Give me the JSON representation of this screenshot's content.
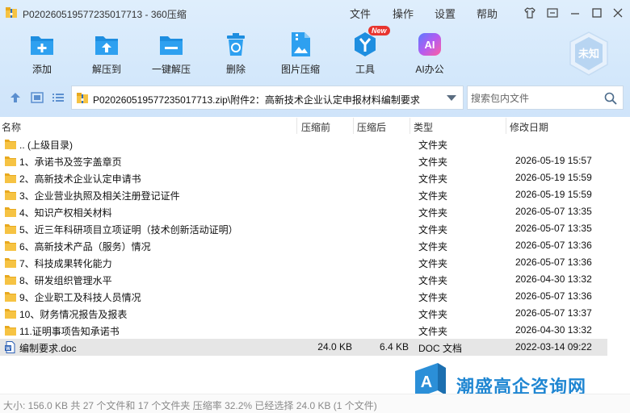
{
  "window": {
    "title": "P020260519577235017713 - 360压缩",
    "menus": [
      "文件",
      "操作",
      "设置",
      "帮助"
    ]
  },
  "toolbar": {
    "items": [
      {
        "label": "添加",
        "icon": "add-icon"
      },
      {
        "label": "解压到",
        "icon": "extract-to-icon"
      },
      {
        "label": "一键解压",
        "icon": "one-click-extract-icon"
      },
      {
        "label": "删除",
        "icon": "delete-icon"
      },
      {
        "label": "图片压缩",
        "icon": "image-compress-icon"
      },
      {
        "label": "工具",
        "icon": "tools-icon"
      },
      {
        "label": "AI办公",
        "icon": "ai-office-icon"
      }
    ],
    "new_badge": "New",
    "ai_icon_text": "AI",
    "account_badge": "未知"
  },
  "address": {
    "path": "P020260519577235017713.zip\\附件2：高新技术企业认定申报材料编制要求"
  },
  "search": {
    "placeholder": "搜索包内文件"
  },
  "columns": {
    "name": "名称",
    "original_size": "压缩前",
    "compressed_size": "压缩后",
    "type": "类型",
    "modified": "修改日期"
  },
  "files": [
    {
      "name": ".. (上级目录)",
      "original": "",
      "compressed": "",
      "type": "文件夹",
      "date": "",
      "kind": "folder"
    },
    {
      "name": "1、承诺书及签字盖章页",
      "original": "",
      "compressed": "",
      "type": "文件夹",
      "date": "2026-05-19 15:57",
      "kind": "folder"
    },
    {
      "name": "2、高新技术企业认定申请书",
      "original": "",
      "compressed": "",
      "type": "文件夹",
      "date": "2026-05-19 15:59",
      "kind": "folder"
    },
    {
      "name": "3、企业营业执照及相关注册登记证件",
      "original": "",
      "compressed": "",
      "type": "文件夹",
      "date": "2026-05-19 15:59",
      "kind": "folder"
    },
    {
      "name": "4、知识产权相关材料",
      "original": "",
      "compressed": "",
      "type": "文件夹",
      "date": "2026-05-07 13:35",
      "kind": "folder"
    },
    {
      "name": "5、近三年科研项目立项证明（技术创新活动证明）",
      "original": "",
      "compressed": "",
      "type": "文件夹",
      "date": "2026-05-07 13:35",
      "kind": "folder"
    },
    {
      "name": "6、高新技术产品（服务）情况",
      "original": "",
      "compressed": "",
      "type": "文件夹",
      "date": "2026-05-07 13:36",
      "kind": "folder"
    },
    {
      "name": "7、科技成果转化能力",
      "original": "",
      "compressed": "",
      "type": "文件夹",
      "date": "2026-05-07 13:36",
      "kind": "folder"
    },
    {
      "name": "8、研发组织管理水平",
      "original": "",
      "compressed": "",
      "type": "文件夹",
      "date": "2026-04-30 13:32",
      "kind": "folder"
    },
    {
      "name": "9、企业职工及科技人员情况",
      "original": "",
      "compressed": "",
      "type": "文件夹",
      "date": "2026-05-07 13:36",
      "kind": "folder"
    },
    {
      "name": "10、财务情况报告及报表",
      "original": "",
      "compressed": "",
      "type": "文件夹",
      "date": "2026-05-07 13:37",
      "kind": "folder"
    },
    {
      "name": "11.证明事项告知承诺书",
      "original": "",
      "compressed": "",
      "type": "文件夹",
      "date": "2026-04-30 13:32",
      "kind": "folder"
    },
    {
      "name": "编制要求.doc",
      "original": "24.0 KB",
      "compressed": "6.4 KB",
      "type": "DOC 文档",
      "date": "2022-03-14 09:22",
      "kind": "doc"
    }
  ],
  "watermark": {
    "text": "潮盛高企咨询网",
    "logo_letter": "A"
  },
  "status": {
    "text": "大小: 156.0 KB 共 27 个文件和 17 个文件夹 压缩率 32.2% 已经选择 24.0 KB (1 个文件)"
  },
  "colors": {
    "toolbar_bg": "#d4e8fb",
    "accent": "#1e8ee0",
    "folder": "#f6c343",
    "selection": "#e6e6e6",
    "watermark": "#1f86d2"
  }
}
